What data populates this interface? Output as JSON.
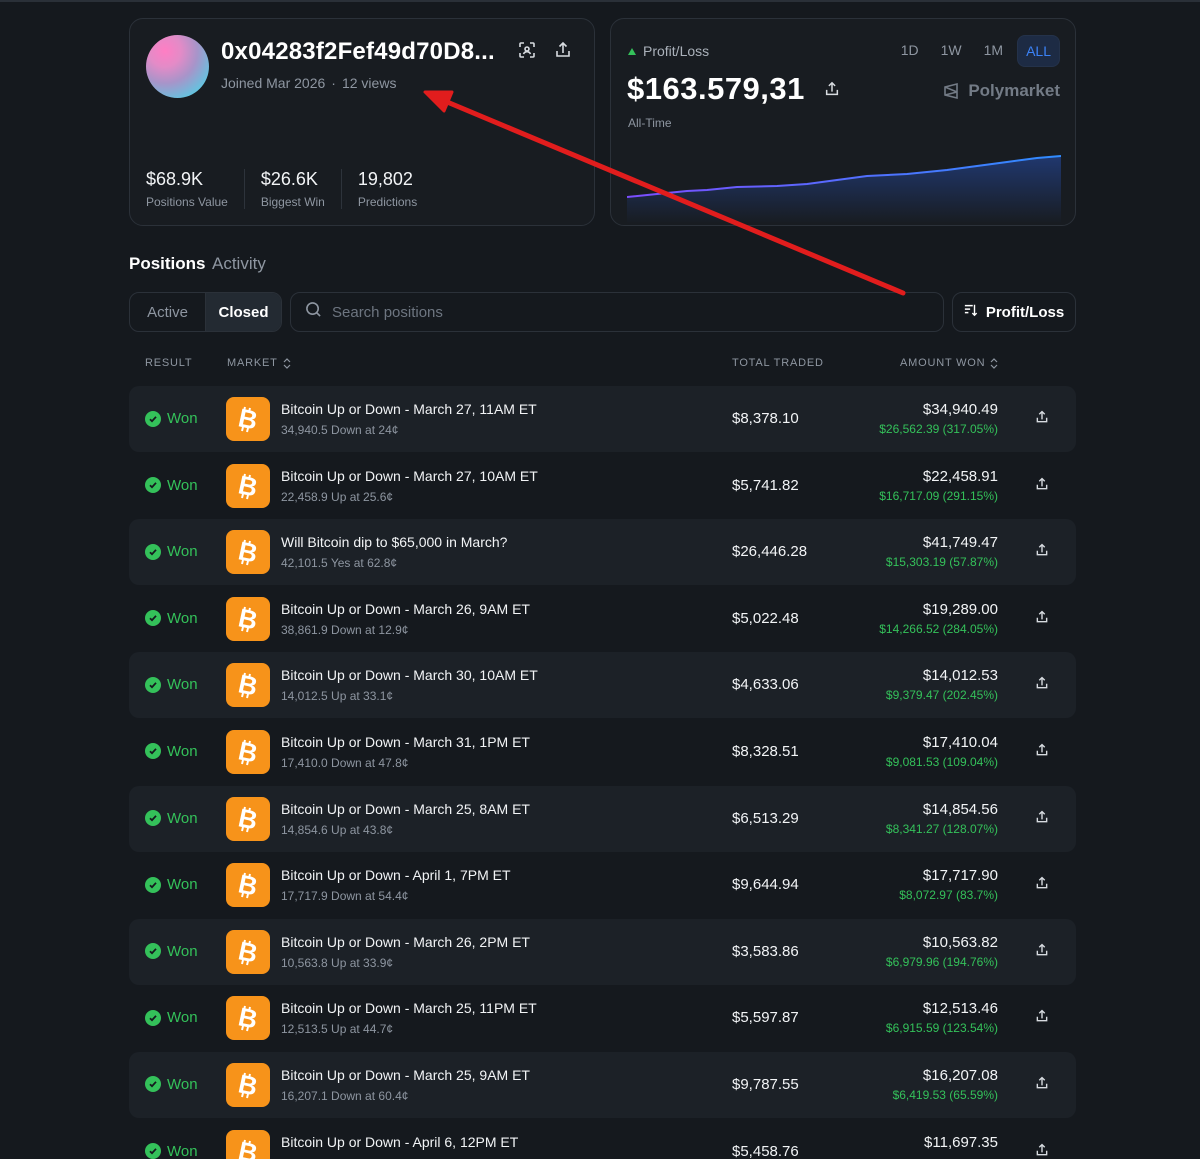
{
  "profile": {
    "wallet": "0x04283f2Fef49d70D8...",
    "joined": "Joined Mar 2026",
    "views": "12 views",
    "stats": [
      {
        "value": "$68.9K",
        "label": "Positions Value"
      },
      {
        "value": "$26.6K",
        "label": "Biggest Win"
      },
      {
        "value": "19,802",
        "label": "Predictions"
      }
    ]
  },
  "pnl": {
    "label": "Profit/Loss",
    "value": "$163.579,31",
    "period": "All-Time",
    "ranges": [
      "1D",
      "1W",
      "1M",
      "ALL"
    ],
    "active_range": "ALL",
    "brand": "Polymarket",
    "colors": {
      "line_start": "#7c4dff",
      "line_end": "#2f8cff",
      "positive": "#34c15a",
      "accent": "#3b82f6"
    }
  },
  "tabs": {
    "positions": "Positions",
    "activity": "Activity"
  },
  "filters": {
    "active": "Active",
    "closed": "Closed",
    "search_placeholder": "Search positions",
    "sort_label": "Profit/Loss"
  },
  "table": {
    "headers": {
      "result": "RESULT",
      "market": "MARKET",
      "total": "TOTAL TRADED",
      "amount": "AMOUNT WON"
    },
    "rows": [
      {
        "result": "Won",
        "title": "Bitcoin Up or Down - March 27, 11AM ET",
        "sub": "34,940.5 Down at 24¢",
        "total": "$8,378.10",
        "amount": "$34,940.49",
        "pnl": "$26,562.39 (317.05%)"
      },
      {
        "result": "Won",
        "title": "Bitcoin Up or Down - March 27, 10AM ET",
        "sub": "22,458.9 Up at 25.6¢",
        "total": "$5,741.82",
        "amount": "$22,458.91",
        "pnl": "$16,717.09 (291.15%)"
      },
      {
        "result": "Won",
        "title": "Will Bitcoin dip to $65,000 in March?",
        "sub": "42,101.5 Yes at 62.8¢",
        "total": "$26,446.28",
        "amount": "$41,749.47",
        "pnl": "$15,303.19 (57.87%)"
      },
      {
        "result": "Won",
        "title": "Bitcoin Up or Down - March 26, 9AM ET",
        "sub": "38,861.9 Down at 12.9¢",
        "total": "$5,022.48",
        "amount": "$19,289.00",
        "pnl": "$14,266.52 (284.05%)"
      },
      {
        "result": "Won",
        "title": "Bitcoin Up or Down - March 30, 10AM ET",
        "sub": "14,012.5 Up at 33.1¢",
        "total": "$4,633.06",
        "amount": "$14,012.53",
        "pnl": "$9,379.47 (202.45%)"
      },
      {
        "result": "Won",
        "title": "Bitcoin Up or Down - March 31, 1PM ET",
        "sub": "17,410.0 Down at 47.8¢",
        "total": "$8,328.51",
        "amount": "$17,410.04",
        "pnl": "$9,081.53 (109.04%)"
      },
      {
        "result": "Won",
        "title": "Bitcoin Up or Down - March 25, 8AM ET",
        "sub": "14,854.6 Up at 43.8¢",
        "total": "$6,513.29",
        "amount": "$14,854.56",
        "pnl": "$8,341.27 (128.07%)"
      },
      {
        "result": "Won",
        "title": "Bitcoin Up or Down - April 1, 7PM ET",
        "sub": "17,717.9 Down at 54.4¢",
        "total": "$9,644.94",
        "amount": "$17,717.90",
        "pnl": "$8,072.97 (83.7%)"
      },
      {
        "result": "Won",
        "title": "Bitcoin Up or Down - March 26, 2PM ET",
        "sub": "10,563.8 Up at 33.9¢",
        "total": "$3,583.86",
        "amount": "$10,563.82",
        "pnl": "$6,979.96 (194.76%)"
      },
      {
        "result": "Won",
        "title": "Bitcoin Up or Down - March 25, 11PM ET",
        "sub": "12,513.5 Up at 44.7¢",
        "total": "$5,597.87",
        "amount": "$12,513.46",
        "pnl": "$6,915.59 (123.54%)"
      },
      {
        "result": "Won",
        "title": "Bitcoin Up or Down - March 25, 9AM ET",
        "sub": "16,207.1 Down at 60.4¢",
        "total": "$9,787.55",
        "amount": "$16,207.08",
        "pnl": "$6,419.53 (65.59%)"
      },
      {
        "result": "Won",
        "title": "Bitcoin Up or Down - April 6, 12PM ET",
        "sub": "",
        "total": "$5,458.76",
        "amount": "$11,697.35",
        "pnl": ""
      }
    ]
  }
}
